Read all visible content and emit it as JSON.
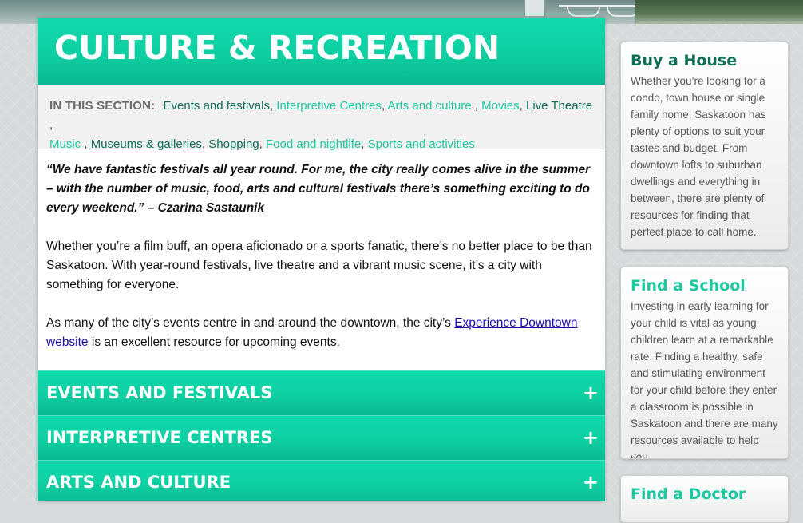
{
  "hero": {
    "title": "CULTURE & RECREATION"
  },
  "in_section": {
    "label": "IN THIS SECTION:",
    "links": [
      {
        "text": "Events and festivals",
        "style": "dark"
      },
      {
        "text": "Interpretive Centres",
        "style": "teal"
      },
      {
        "text": "Arts and culture",
        "style": "teal"
      },
      {
        "text": "Movies",
        "style": "teal"
      },
      {
        "text": "Live Theatre",
        "style": "dark"
      },
      {
        "text": "Music",
        "style": "teal"
      },
      {
        "text": "Museums & galleries",
        "style": "ul"
      },
      {
        "text": "Shopping",
        "style": "dark"
      },
      {
        "text": "Food and nightlife",
        "style": "teal"
      },
      {
        "text": "Sports and activities",
        "style": "teal"
      }
    ]
  },
  "content": {
    "quote": "“We have fantastic festivals all year round. For me, the city really comes alive in the summer – with the number of music, food, arts and cultural festivals there’s something exciting to do every weekend.” – Czarina Sastaunik",
    "para1": "Whether you’re a film buff, an opera aficionado or a sports fanatic, there’s no better place to be than Saskatoon. With year-round festivals, live theatre and a vibrant music scene, it’s a city with something for everyone.",
    "para2_before": "As many of the city’s events centre in and around the downtown, the city’s ",
    "para2_link": "Experience Downtown website",
    "para2_after": " is an excellent resource for upcoming events."
  },
  "accordion": [
    {
      "title": "EVENTS AND FESTIVALS",
      "icon": "+"
    },
    {
      "title": "INTERPRETIVE CENTRES",
      "icon": "+"
    },
    {
      "title": "ARTS AND CULTURE",
      "icon": "+"
    }
  ],
  "sidebar": [
    {
      "title": "Buy a House",
      "title_color": "#0e6e56",
      "text": "Whether you’re looking for a condo, town house or single family home, Saskatoon has plenty of options to suit your tastes and budget. From downtown lofts to suburban dwellings and everything in between, there are plenty of resources for finding that perfect place to call home."
    },
    {
      "title": "Find a School",
      "title_color": "#1ec9a1",
      "text": "Investing in early learning for your child is vital as young children learn at a remarkable rate. Finding a healthy, safe and stimulating environment for your child before they enter a classroom is possible in Saskatoon and there are many resources available to help you."
    },
    {
      "title": "Find a Doctor",
      "title_color": "#1ec9a1",
      "text": ""
    }
  ],
  "colors": {
    "accent": "#12d9ae",
    "accent_dark": "#0e6e56",
    "link": "#1a0dab"
  }
}
